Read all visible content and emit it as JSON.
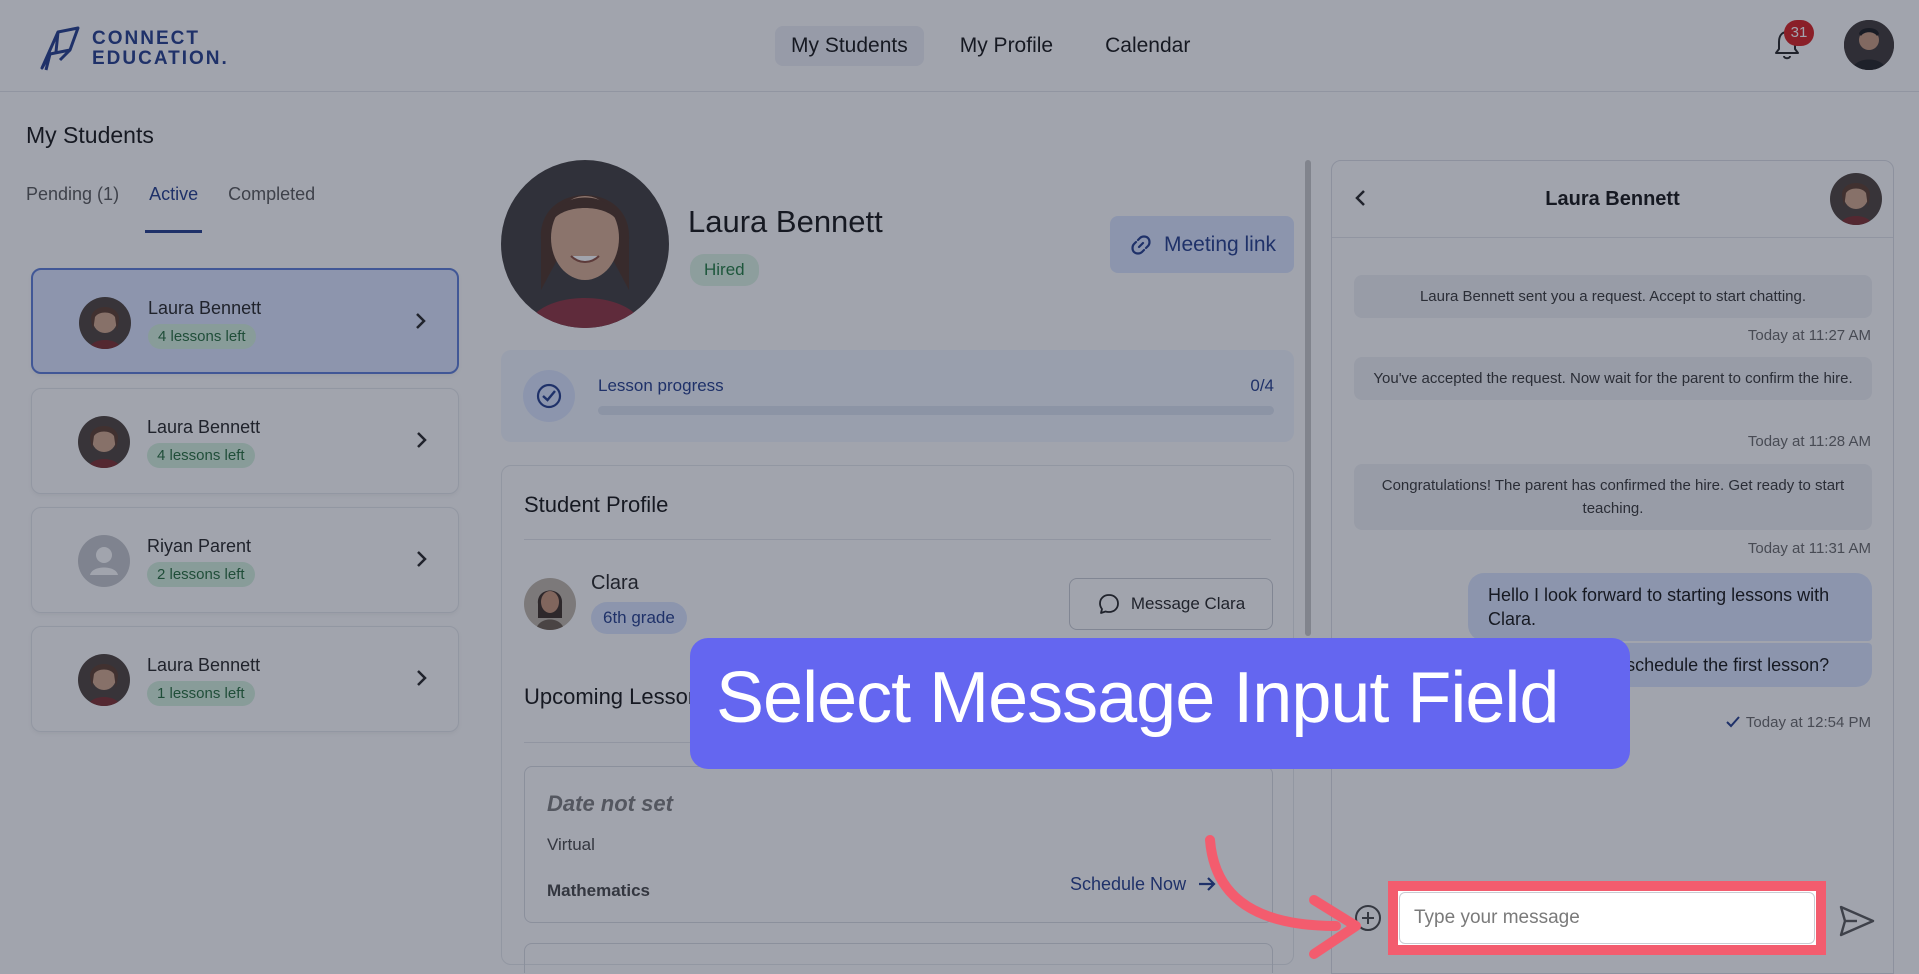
{
  "header": {
    "logo_line1": "CONNECT",
    "logo_line2": "EDUCATION.",
    "nav": [
      "My Students",
      "My Profile",
      "Calendar"
    ],
    "notification_count": "31",
    "brand_color": "#1f3a8a"
  },
  "page": {
    "title": "My Students",
    "tabs": [
      "Pending (1)",
      "Active",
      "Completed"
    ],
    "active_tab": "Active"
  },
  "students": [
    {
      "name": "Laura Bennett",
      "lessons": "4 lessons left",
      "selected": true
    },
    {
      "name": "Laura Bennett",
      "lessons": "4 lessons left",
      "selected": false
    },
    {
      "name": "Riyan Parent",
      "lessons": "2 lessons left",
      "selected": false
    },
    {
      "name": "Laura Bennett",
      "lessons": "1 lessons left",
      "selected": false
    }
  ],
  "profile": {
    "name": "Laura Bennett",
    "status": "Hired",
    "meeting_button": "Meeting link",
    "progress_label": "Lesson progress",
    "progress_count": "0/4",
    "progress_fraction": 0
  },
  "student_profile": {
    "title": "Student Profile",
    "child_name": "Clara",
    "grade": "6th grade",
    "message_button": "Message Clara",
    "upcoming_title": "Upcoming Lessons",
    "lesson": {
      "date": "Date not set",
      "mode": "Virtual",
      "subject": "Mathematics",
      "action": "Schedule Now"
    }
  },
  "chat": {
    "title": "Laura Bennett",
    "messages": [
      {
        "text": "Laura Bennett sent you a request. Accept to start chatting.",
        "time": "Today at 11:27 AM"
      },
      {
        "text": "You've accepted the request. Now wait for the parent to confirm the hire.",
        "time": "Today at 11:28 AM"
      },
      {
        "text": "Congratulations! The parent has confirmed the hire. Get ready to start teaching.",
        "time": "Today at 11:31 AM"
      }
    ],
    "my_message_1": "Hello I look forward to starting lessons with Clara.",
    "my_message_2": "When should we schedule the first lesson?",
    "sent_time": "Today at 12:54 PM",
    "input_placeholder": "Type your message"
  },
  "overlay": {
    "callout_text": "Select Message Input Field",
    "callout_color": "#6466f0",
    "highlight_color": "#f35c6e"
  }
}
